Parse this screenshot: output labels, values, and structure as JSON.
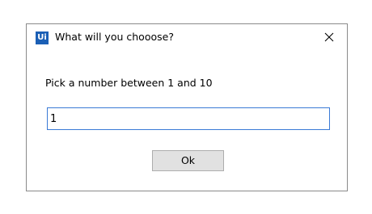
{
  "window": {
    "app_icon_text": "Ui",
    "title": "What will you chooose?",
    "close_icon": "close-icon"
  },
  "prompt": {
    "label": "Pick a number between 1 and 10"
  },
  "input": {
    "value": "1"
  },
  "actions": {
    "ok_label": "Ok"
  },
  "colors": {
    "app_icon_bg": "#1b5fb5",
    "input_focus_border": "#3a7ad6",
    "button_bg": "#e1e1e1"
  }
}
